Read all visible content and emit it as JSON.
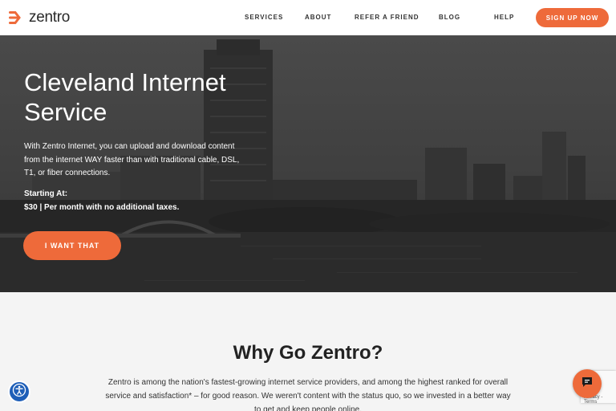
{
  "brand": {
    "name": "zentro",
    "accent_color": "#ee6a3a"
  },
  "nav": {
    "items": [
      {
        "label": "SERVICES"
      },
      {
        "label": "ABOUT"
      },
      {
        "label": "REFER A FRIEND"
      },
      {
        "label": "BLOG"
      },
      {
        "label": "HELP"
      }
    ],
    "signup_label": "SIGN UP NOW"
  },
  "hero": {
    "title": "Cleveland Internet Service",
    "description": "With Zentro Internet, you can upload and download content from the internet WAY faster than with traditional cable, DSL, T1, or fiber connections.",
    "price_label": "Starting At:",
    "price": "$30 | Per month with no additional taxes.",
    "cta_label": "I WANT THAT"
  },
  "why": {
    "title": "Why Go Zentro?",
    "body": "Zentro is among the nation's fastest-growing internet service providers, and among the highest ranked for overall service and satisfaction* – for good reason. We weren't content with the status quo, so we invested in a better way to get and keep people online."
  },
  "widgets": {
    "accessibility_icon": "accessibility-icon",
    "chat_icon": "chat-icon",
    "recaptcha_text": "Privacy - Terms"
  }
}
